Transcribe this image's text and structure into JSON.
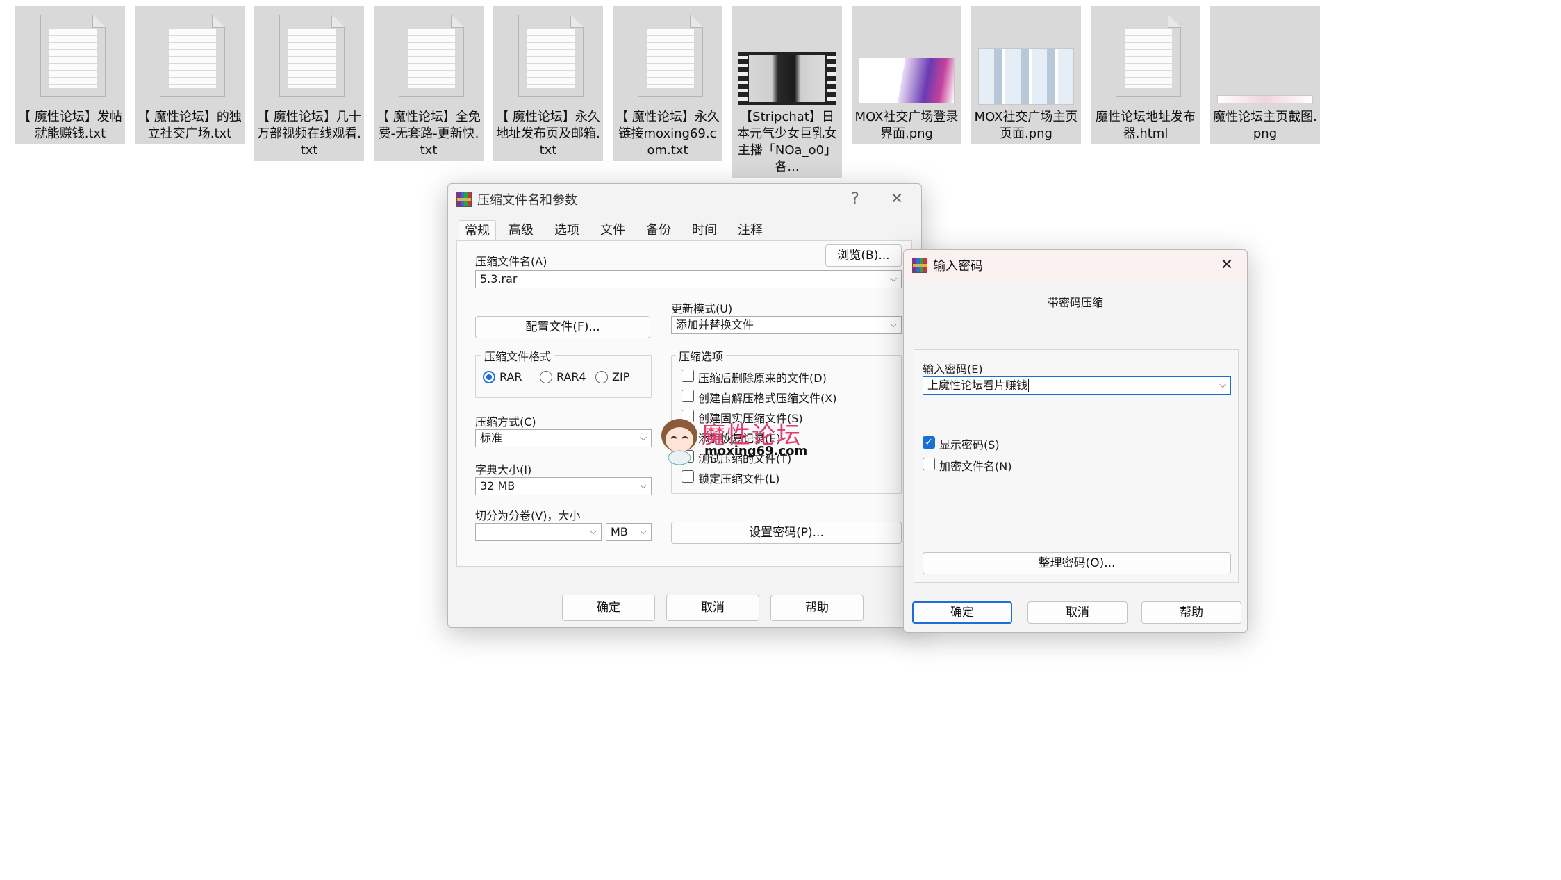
{
  "files": [
    {
      "type": "txt",
      "label": "【 魔性论坛】发帖就能赚钱.txt"
    },
    {
      "type": "txt",
      "label": "【 魔性论坛】的独立社交广场.txt"
    },
    {
      "type": "txt",
      "label": "【 魔性论坛】几十万部视频在线观看.txt"
    },
    {
      "type": "txt",
      "label": "【 魔性论坛】全免费-无套路-更新快.txt"
    },
    {
      "type": "txt",
      "label": "【 魔性论坛】永久地址发布页及邮箱.txt"
    },
    {
      "type": "txt",
      "label": "【 魔性论坛】永久链接moxing69.com.txt"
    },
    {
      "type": "video",
      "label": "【Stripchat】日本元气少女巨乳女主播「NOa_o0」各..."
    },
    {
      "type": "png",
      "label": "MOX社交广场登录界面.png"
    },
    {
      "type": "png",
      "label": "MOX社交广场主页页面.png"
    },
    {
      "type": "txt",
      "label": "魔性论坛地址发布器.html"
    },
    {
      "type": "png",
      "label": "魔性论坛主页截图.png"
    }
  ],
  "archive_dialog": {
    "title": "压缩文件名和参数",
    "help_icon": "?",
    "close_icon": "✕",
    "tabs": [
      "常规",
      "高级",
      "选项",
      "文件",
      "备份",
      "时间",
      "注释"
    ],
    "archive_name_label": "压缩文件名(A)",
    "browse_button": "浏览(B)...",
    "archive_name_value": "5.3.rar",
    "update_mode_label": "更新模式(U)",
    "update_mode_value": "添加并替换文件",
    "profiles_button": "配置文件(F)...",
    "format_label": "压缩文件格式",
    "formats": [
      "RAR",
      "RAR4",
      "ZIP"
    ],
    "method_label": "压缩方式(C)",
    "method_value": "标准",
    "dict_label": "字典大小(I)",
    "dict_value": "32 MB",
    "split_label": "切分为分卷(V)，大小",
    "split_value": "",
    "split_unit": "MB",
    "options_label": "压缩选项",
    "options": [
      {
        "label": "压缩后删除原来的文件(D)",
        "checked": false
      },
      {
        "label": "创建自解压格式压缩文件(X)",
        "checked": false
      },
      {
        "label": "创建固实压缩文件(S)",
        "checked": false
      },
      {
        "label": "添加恢复记录(E)",
        "checked": false
      },
      {
        "label": "测试压缩的文件(T)",
        "checked": false
      },
      {
        "label": "锁定压缩文件(L)",
        "checked": false
      }
    ],
    "set_password_button": "设置密码(P)...",
    "ok_button": "确定",
    "cancel_button": "取消",
    "help_button": "帮助"
  },
  "watermark": {
    "text": "魔性论坛",
    "url": "moxing69.com"
  },
  "password_dialog": {
    "title": "输入密码",
    "close_icon": "✕",
    "subtitle": "带密码压缩",
    "password_label": "输入密码(E)",
    "password_value": "上魔性论坛看片赚钱",
    "show_password": "显示密码(S)",
    "encrypt_names": "加密文件名(N)",
    "organize_button": "整理密码(O)...",
    "ok_button": "确定",
    "cancel_button": "取消",
    "help_button": "帮助"
  },
  "colors": {
    "accent": "#1a6fd6",
    "tile_bg": "#d9d9d9",
    "watermark": "#e23b6b"
  }
}
